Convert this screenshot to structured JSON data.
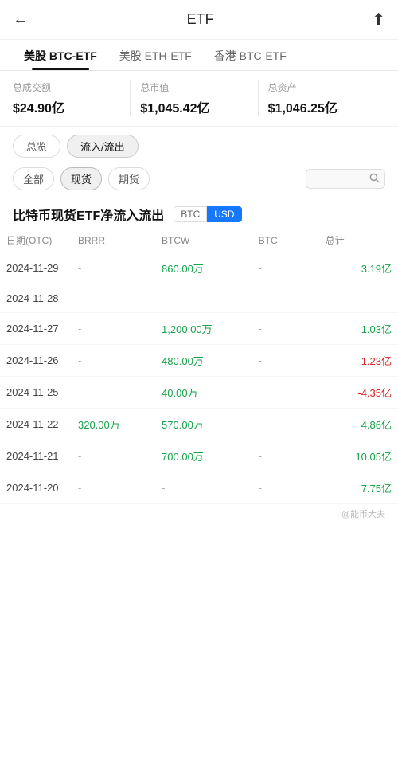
{
  "header": {
    "title": "ETF",
    "back_icon": "←",
    "share_icon": "⬆"
  },
  "tabs": [
    {
      "id": "btc-etf",
      "label": "美股 BTC-ETF",
      "active": true
    },
    {
      "id": "eth-etf",
      "label": "美股 ETH-ETF",
      "active": false
    },
    {
      "id": "hk-btc-etf",
      "label": "香港 BTC-ETF",
      "active": false
    }
  ],
  "stats": [
    {
      "label": "总成交额",
      "value": "$24.90亿"
    },
    {
      "label": "总市值",
      "value": "$1,045.42亿"
    },
    {
      "label": "总资产",
      "value": "$1,046.25亿"
    }
  ],
  "filter1": {
    "buttons": [
      {
        "label": "总览",
        "active": false
      },
      {
        "label": "流入/流出",
        "active": true
      }
    ]
  },
  "filter2": {
    "buttons": [
      {
        "label": "全部",
        "active": false
      },
      {
        "label": "现货",
        "active": true
      },
      {
        "label": "期货",
        "active": false
      }
    ],
    "search_placeholder": ""
  },
  "section_title": "比特币现货ETF净流入流出",
  "currency_toggle": [
    {
      "label": "BTC",
      "active": false
    },
    {
      "label": "USD",
      "active": true
    }
  ],
  "table": {
    "headers": [
      {
        "key": "date",
        "label": "日期(OTC)"
      },
      {
        "key": "brrr",
        "label": "BRRR"
      },
      {
        "key": "btcw",
        "label": "BTCW"
      },
      {
        "key": "btc",
        "label": "BTC"
      },
      {
        "key": "total",
        "label": "总计"
      }
    ],
    "rows": [
      {
        "date": "2024-11-29",
        "ibit": "·",
        "brrr": "-",
        "btcw": "860.00万",
        "btcw_color": "green",
        "btc": "-",
        "btc_color": "dash",
        "total": "3.19亿",
        "total_color": "green"
      },
      {
        "date": "2024-11-28",
        "ibit": "·",
        "brrr": "-",
        "btcw": "-",
        "btcw_color": "dash",
        "btc": "-",
        "btc_color": "dash",
        "total": "-",
        "total_color": "dash"
      },
      {
        "date": "2024-11-27",
        "ibit": "·",
        "brrr": "-",
        "btcw": "1,200.00万",
        "btcw_color": "green",
        "btc": "-",
        "btc_color": "dash",
        "total": "1.03亿",
        "total_color": "green"
      },
      {
        "date": "2024-11-26",
        "ibit": "·",
        "brrr": "-",
        "btcw": "480.00万",
        "btcw_color": "green",
        "btc": "-",
        "btc_color": "dash",
        "total": "-1.23亿",
        "total_color": "red"
      },
      {
        "date": "2024-11-25",
        "ibit": "·",
        "brrr": "-",
        "btcw": "40.00万",
        "btcw_color": "green",
        "btc": "-",
        "btc_color": "dash",
        "total": "-4.35亿",
        "total_color": "red"
      },
      {
        "date": "2024-11-22",
        "ibit": "·",
        "brrr": "320.00万",
        "btcw": "570.00万",
        "btcw_color": "green",
        "btc": "-",
        "btc_color": "dash",
        "total": "4.86亿",
        "total_color": "green"
      },
      {
        "date": "2024-11-21",
        "ibit": "·",
        "brrr": "-",
        "btcw": "700.00万",
        "btcw_color": "green",
        "btc": "-",
        "btc_color": "dash",
        "total": "10.05亿",
        "total_color": "green"
      },
      {
        "date": "2024-11-20",
        "ibit": "·",
        "brrr": "-",
        "btcw": "-",
        "btcw_color": "dash",
        "btc": "-",
        "btc_color": "dash",
        "total": "7.75亿",
        "total_color": "green"
      }
    ]
  },
  "watermark": "@能币大夫"
}
